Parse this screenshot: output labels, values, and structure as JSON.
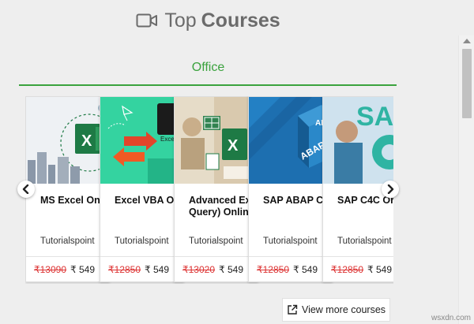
{
  "header": {
    "title_light": "Top",
    "title_bold": "Courses",
    "icon": "video-camera-icon"
  },
  "tabs": [
    {
      "label": "Office",
      "active": true
    }
  ],
  "courses": [
    {
      "title": "MS Excel On",
      "author": "Tutorialspoint",
      "old_price": "₹13090",
      "new_price": "₹ 549"
    },
    {
      "title": "Excel VBA O",
      "author": "Tutorialspoint",
      "old_price": "₹12850",
      "new_price": "₹ 549"
    },
    {
      "title_line1": "Advanced Ex",
      "title_line2": "Query) Onlin",
      "author": "Tutorialspoint",
      "old_price": "₹13020",
      "new_price": "₹ 549"
    },
    {
      "title": "SAP ABAP C",
      "author": "Tutorialspoint",
      "old_price": "₹12850",
      "new_price": "₹ 549"
    },
    {
      "title": "SAP C4C Or",
      "author": "Tutorialspoint",
      "old_price": "₹12850",
      "new_price": "₹ 549"
    }
  ],
  "nav": {
    "prev": "chevron-left-icon",
    "next": "chevron-right-icon"
  },
  "more_button": {
    "label": "View more courses",
    "icon": "external-link-icon"
  },
  "watermark": "wsxdn.com",
  "colors": {
    "accent": "#3aa23d",
    "old_price": "#dd3333"
  }
}
